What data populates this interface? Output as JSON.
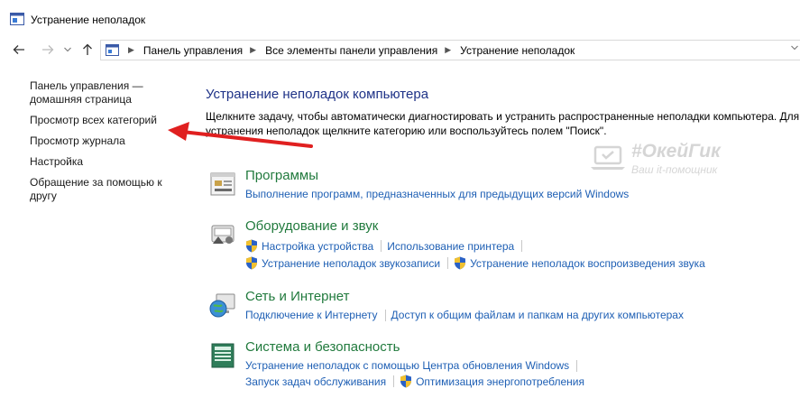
{
  "window": {
    "title": "Устранение неполадок"
  },
  "nav": {
    "back_icon": "arrow-left-icon",
    "forward_icon": "arrow-right-icon",
    "recent_icon": "chevron-down-icon",
    "up_icon": "arrow-up-icon"
  },
  "breadcrumb": [
    "Панель управления",
    "Все элементы панели управления",
    "Устранение неполадок"
  ],
  "sidebar": {
    "home_line1": "Панель управления —",
    "home_line2": "домашняя страница",
    "all_categories": "Просмотр всех категорий",
    "history": "Просмотр журнала",
    "settings": "Настройка",
    "help_line1": "Обращение за помощью к",
    "help_line2": "другу"
  },
  "main": {
    "title": "Устранение неполадок компьютера",
    "desc_line1": "Щелкните задачу, чтобы автоматически диагностировать и устранить распространенные неполадки компьютера. Для",
    "desc_line2": "устранения неполадок щелкните категорию или воспользуйтесь полем \"Поиск\"."
  },
  "categories": [
    {
      "title": "Программы",
      "links": [
        "Выполнение программ, предназначенных для предыдущих версий Windows"
      ]
    },
    {
      "title": "Оборудование и звук",
      "links": [
        "Настройка устройства",
        "Использование принтера",
        "Устранение неполадок звукозаписи",
        "Устранение неполадок воспроизведения звука"
      ]
    },
    {
      "title": "Сеть и Интернет",
      "links": [
        "Подключение к Интернету",
        "Доступ к общим файлам и папкам на других компьютерах"
      ]
    },
    {
      "title": "Система и безопасность",
      "links": [
        "Устранение неполадок с помощью Центра обновления Windows",
        "Запуск задач обслуживания",
        "Оптимизация энергопотребления"
      ]
    }
  ],
  "watermark": {
    "name": "#ОкейГик",
    "tagline": "Ваш it-помощник"
  },
  "colors": {
    "link_blue": "#1e5fb4",
    "category_green": "#217a3d",
    "title_blue": "#1e3287",
    "annotation_red": "#e02020"
  }
}
